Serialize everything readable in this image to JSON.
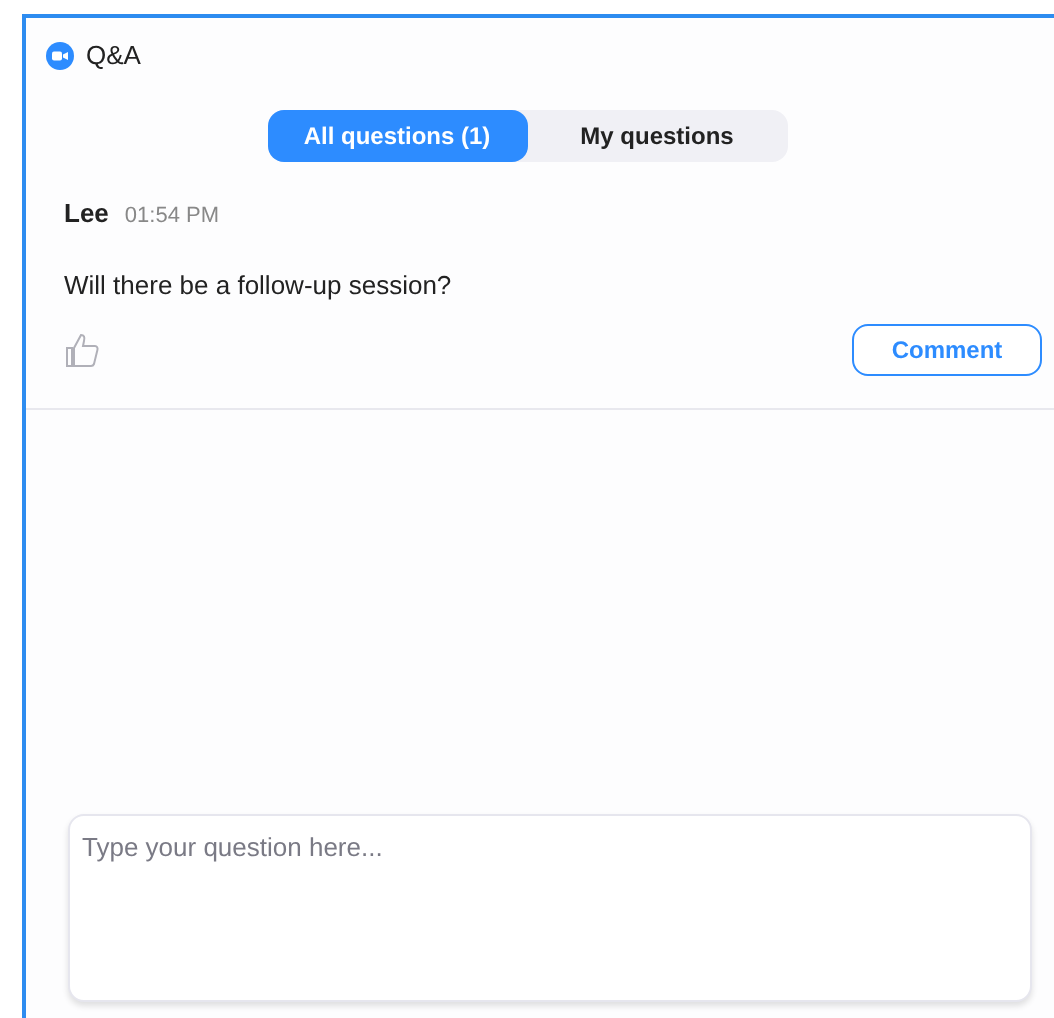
{
  "window": {
    "title": "Q&A"
  },
  "tabs": [
    {
      "label": "All questions (1)",
      "selected": true
    },
    {
      "label": "My questions",
      "selected": false
    }
  ],
  "questions": [
    {
      "author": "Lee",
      "time": "01:54 PM",
      "text": "Will there be a follow-up session?",
      "liked": false,
      "action": "Comment"
    }
  ],
  "input": {
    "placeholder": "Type your question here..."
  }
}
